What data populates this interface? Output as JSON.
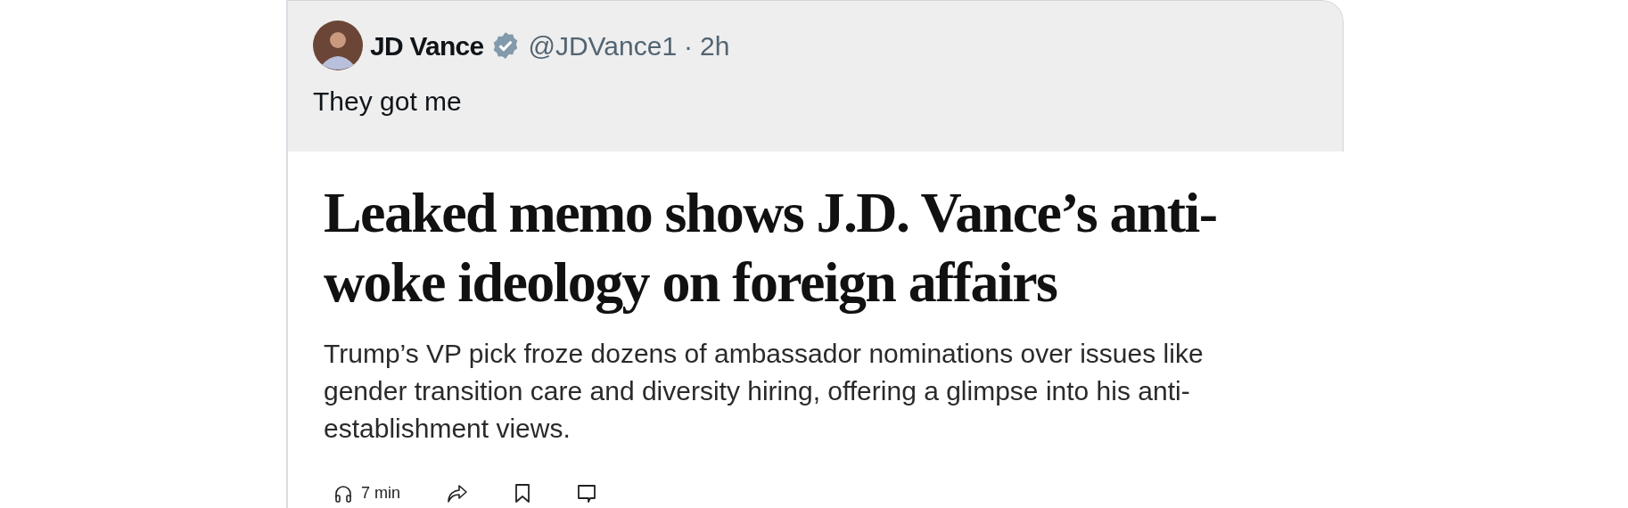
{
  "tweet": {
    "author": "JD Vance",
    "verified": true,
    "handle": "@JDVance1",
    "separator": "·",
    "time": "2h",
    "text": "They got me"
  },
  "article": {
    "headline": "Leaked memo shows J.D. Vance’s anti-woke ideology on foreign affairs",
    "summary": "Trump’s VP pick froze dozens of ambassador nominations over issues like gender transition care and diversity hiring, offering a glimpse into his anti-establishment views.",
    "read_time": "7 min"
  }
}
